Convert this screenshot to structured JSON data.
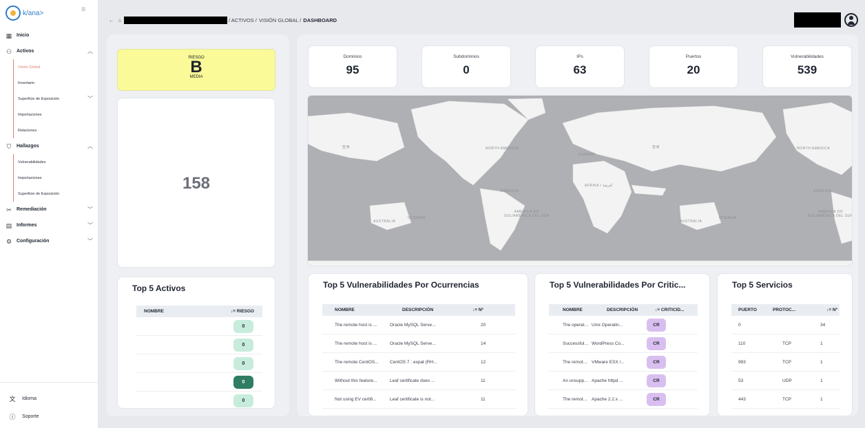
{
  "sidebar": {
    "logo_text": "k/ana>",
    "items": [
      {
        "label": "Inicio"
      },
      {
        "label": "Activos"
      },
      {
        "label": "Hallazgos"
      },
      {
        "label": "Remediación"
      },
      {
        "label": "Informes"
      },
      {
        "label": "Configuración"
      }
    ],
    "activos_sub": [
      {
        "label": "Visión Global"
      },
      {
        "label": "Inventario"
      },
      {
        "label": "Superficie de Exposición"
      },
      {
        "label": "Importaciones"
      },
      {
        "label": "Relaciones"
      }
    ],
    "hallazgos_sub": [
      {
        "label": "Vulnerabilidades"
      },
      {
        "label": "Importaciones"
      },
      {
        "label": "Superficie de Exposición"
      }
    ],
    "bottom": [
      {
        "label": "Idioma"
      },
      {
        "label": "Soporte"
      }
    ]
  },
  "breadcrumb": {
    "seg1": "/ ACTIVOS /",
    "seg2": "VISIÓN GLOBAL /",
    "seg3": "DASHBOARD"
  },
  "risk": {
    "label": "RIESGO",
    "grade": "B",
    "level": "MEDIA"
  },
  "big_number": "158",
  "stats": [
    {
      "label": "Dominios",
      "value": "95"
    },
    {
      "label": "Subdominios",
      "value": "0"
    },
    {
      "label": "IPs",
      "value": "63"
    },
    {
      "label": "Puertos",
      "value": "20"
    },
    {
      "label": "Vulnerabilidades",
      "value": "539"
    }
  ],
  "map": {
    "labels": [
      "NORTH AMERICA",
      "EUROPE",
      "AFRIKA / أفريقيا",
      "AMÉRICA DO SUL/AMÉRICA DEL SUR",
      "AUSTRALIA",
      "OCEANIA",
      "亚洲",
      "AMÉRICA"
    ]
  },
  "top5_activos": {
    "title": "Top 5 Activos",
    "col_name": "NOMBRE",
    "col_risk": "RIESGO",
    "rows": [
      {
        "risk": "0"
      },
      {
        "risk": "0"
      },
      {
        "risk": "0"
      },
      {
        "risk": "0"
      },
      {
        "risk": "0"
      }
    ]
  },
  "top5_vuln_ocurrencias": {
    "title": "Top 5 Vulnerabilidades Por Ocurrencias",
    "cols": [
      "NOMBRE",
      "DESCRIPCIÓN",
      "Nº"
    ],
    "rows": [
      {
        "name": "The remote host is ...",
        "desc": "Oracle MySQL Serve...",
        "n": "20"
      },
      {
        "name": "The remote host is ...",
        "desc": "Oracle MySQL Serve...",
        "n": "14"
      },
      {
        "name": "The remote CentOS...",
        "desc": "CentOS 7 : expat (RH...",
        "n": "12"
      },
      {
        "name": "Without this feature...",
        "desc": "Leaf certificate does ...",
        "n": "11"
      },
      {
        "name": "Not using EV certifi...",
        "desc": "Leaf certificate is not...",
        "n": "11"
      }
    ]
  },
  "top5_vuln_criticidad": {
    "title": "Top 5 Vulnerabilidades Por Critic...",
    "cols": [
      "NOMBRE",
      "DESCRIPCIÓN",
      "CRITICID..."
    ],
    "rows": [
      {
        "name": "The operating ...",
        "desc": "Unix Operatin...",
        "crit": "CR"
      },
      {
        "name": "Successful ex...",
        "desc": "WordPress Co...",
        "crit": "CR"
      },
      {
        "name": "The remote ho...",
        "desc": "VMware ESX /...",
        "crit": "CR"
      },
      {
        "name": "An unsupport...",
        "desc": "Apache httpd ...",
        "crit": "CR"
      },
      {
        "name": "The remote w...",
        "desc": "Apache 2.2.x ...",
        "crit": "CR"
      }
    ]
  },
  "top5_servicios": {
    "title": "Top 5 Servicios",
    "cols": [
      "PUERTO",
      "PROTOC...",
      "Nº"
    ],
    "rows": [
      {
        "port": "0",
        "proto": "",
        "n": "34"
      },
      {
        "port": "110",
        "proto": "TCP",
        "n": "1"
      },
      {
        "port": "993",
        "proto": "TCP",
        "n": "1"
      },
      {
        "port": "53",
        "proto": "UDP",
        "n": "1"
      },
      {
        "port": "443",
        "proto": "TCP",
        "n": "1"
      }
    ]
  },
  "colors": {
    "accent": "#e27f74",
    "risk_bg": "#fafb98",
    "pill_light": "#c7ecdc",
    "pill_dark": "#2f7d62",
    "crit_bg": "#d9bff0"
  }
}
